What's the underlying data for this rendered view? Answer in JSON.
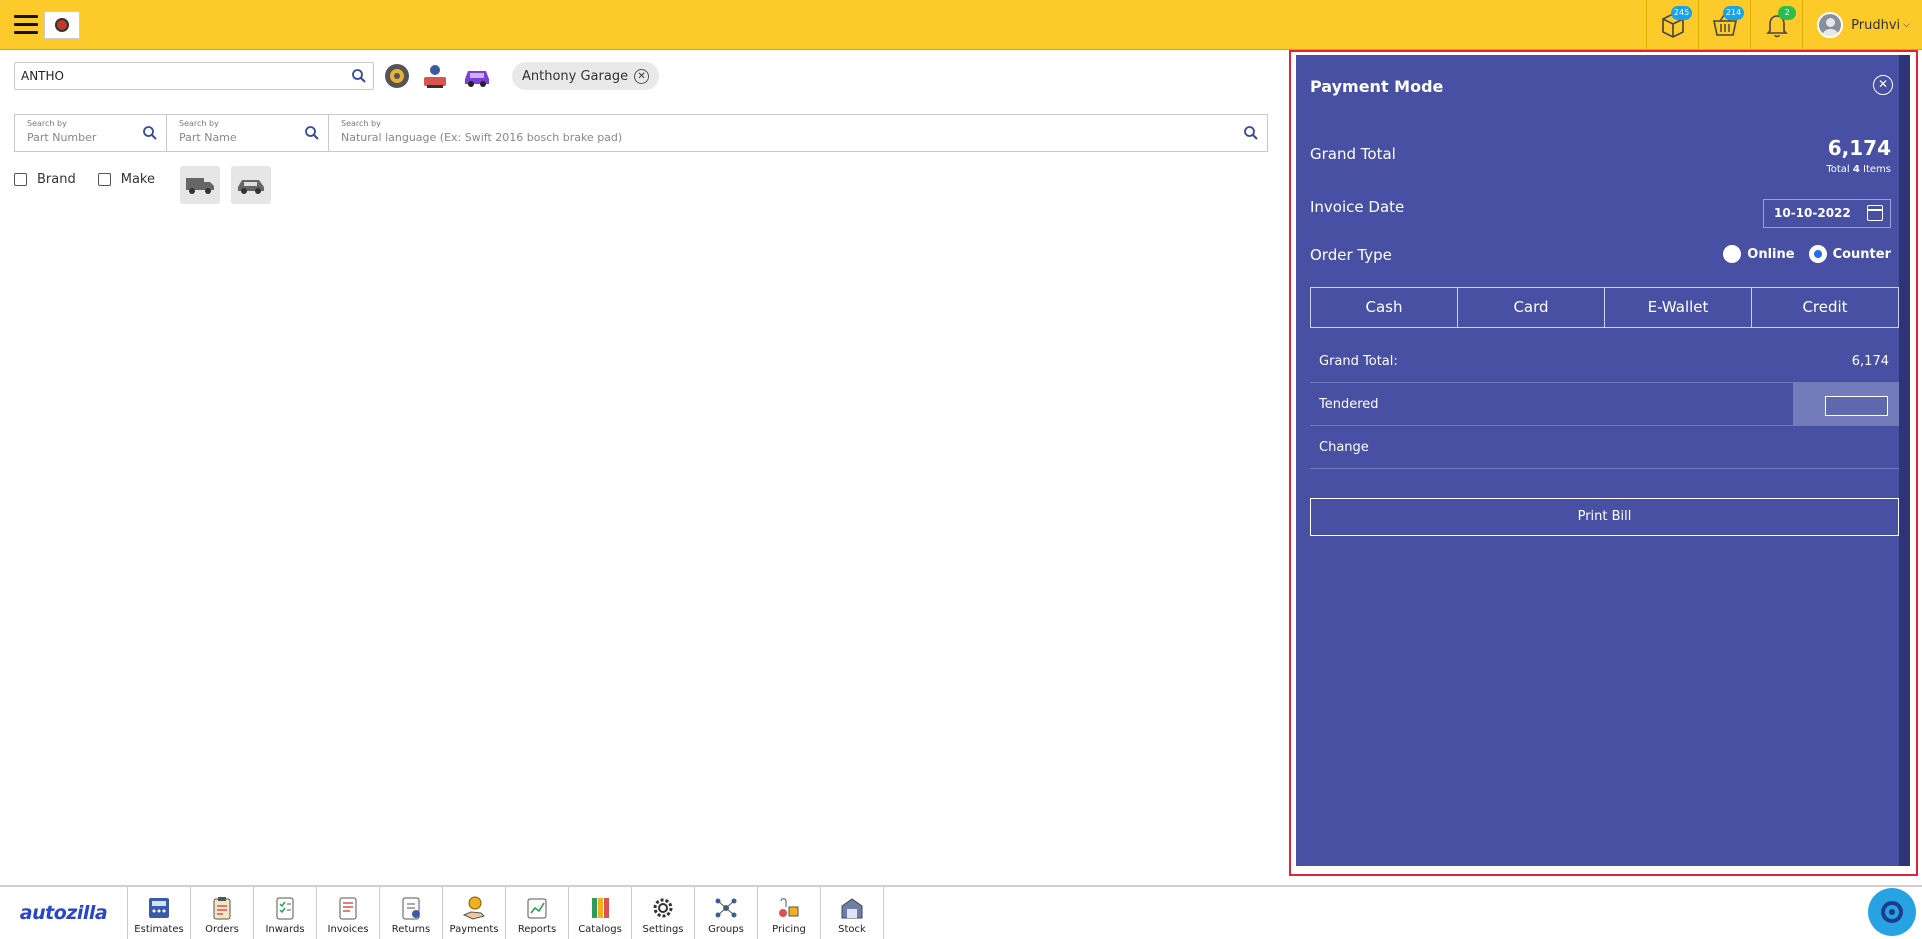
{
  "header": {
    "badges": {
      "box": "245",
      "basket": "214",
      "bell": "2"
    },
    "user_name": "Prudhvi"
  },
  "search": {
    "main_value": "ANTHO",
    "chip_label": "Anthony Garage",
    "multi": [
      {
        "small": "Search by",
        "placeholder": "Part Number"
      },
      {
        "small": "Search by",
        "placeholder": "Part Name"
      },
      {
        "small": "Search by",
        "placeholder": "Natural language (Ex: Swift 2016 bosch brake pad)"
      }
    ]
  },
  "filters": {
    "brand": "Brand",
    "make": "Make"
  },
  "payment": {
    "title": "Payment Mode",
    "grand_total_label": "Grand Total",
    "grand_total_value": "6,174",
    "total_prefix": "Total",
    "total_count": "4",
    "total_suffix": "Items",
    "invoice_date_label": "Invoice Date",
    "invoice_date_value": "10-10-2022",
    "order_type_label": "Order Type",
    "order_types": [
      "Online",
      "Counter"
    ],
    "selected_order_type": "Counter",
    "tabs": [
      "Cash",
      "Card",
      "E-Wallet",
      "Credit"
    ],
    "active_tab": "Cash",
    "summary": {
      "grand_total_label": "Grand Total:",
      "grand_total_value": "6,174",
      "tendered_label": "Tendered",
      "change_label": "Change"
    },
    "print_label": "Print Bill"
  },
  "bottom_nav": {
    "brand": "autozilla",
    "items": [
      "Estimates",
      "Orders",
      "Inwards",
      "Invoices",
      "Returns",
      "Payments",
      "Reports",
      "Catalogs",
      "Settings",
      "Groups",
      "Pricing",
      "Stock"
    ]
  },
  "colors": {
    "topbar": "#fccb2a",
    "panel": "#4750a2",
    "highlight_border": "#e0223a",
    "brand_blue": "#2b45c8"
  }
}
